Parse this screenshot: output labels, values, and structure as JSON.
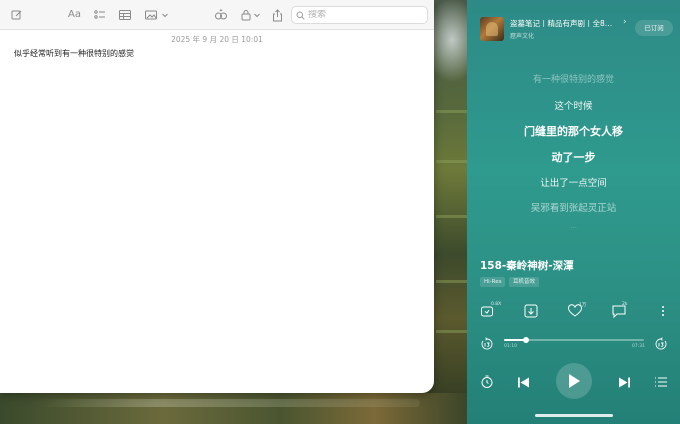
{
  "notes": {
    "search_placeholder": "搜索",
    "font_button": "Aa",
    "date": "2025 年 9 月 20 日 10:01",
    "body": "似乎经常听到有一种很特别的感觉"
  },
  "player": {
    "album_title": "盗墓笔记丨精品有声剧丨全8…",
    "album_chevron": "›",
    "album_subtitle": "窟声文化",
    "subscribe_label": "已订阅",
    "lyrics": [
      {
        "text": "有一种很特别的感觉",
        "state": "past"
      },
      {
        "text": "这个时候",
        "state": "near"
      },
      {
        "text": "门缝里的那个女人移",
        "state": "current"
      },
      {
        "text": "动了一步",
        "state": "current"
      },
      {
        "text": "让出了一点空间",
        "state": "near"
      },
      {
        "text": "吴邪看到张起灵正站",
        "state": "far"
      },
      {
        "text": "…",
        "state": "fade"
      }
    ],
    "track_title": "158-秦岭神树-深潭",
    "tags": [
      "Hi-Res",
      "耳机音效"
    ],
    "actions": {
      "speed_badge": "0.8X",
      "like_count": "1万",
      "comment_count": "2k"
    },
    "progress": {
      "current": "01:10",
      "total": "07:31",
      "fraction": 0.16
    }
  },
  "colors": {
    "player_accent": "#2f9a8e",
    "notes_bg": "#ffffff"
  }
}
